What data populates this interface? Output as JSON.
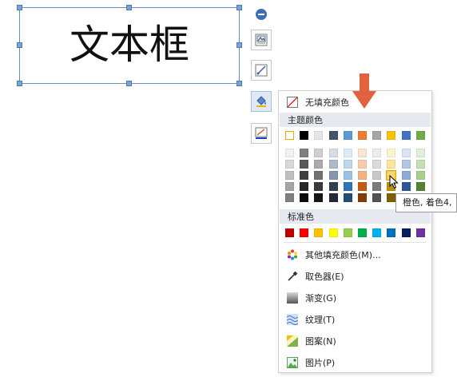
{
  "textbox": {
    "text": "文本框"
  },
  "dropdown": {
    "no_fill_label": "无填充颜色",
    "theme_colors_header": "主题颜色",
    "standard_colors_header": "标准色",
    "theme_top_row": [
      "#ffffff",
      "#000000",
      "#e7e6e6",
      "#44546a",
      "#5b9bd5",
      "#ed7d31",
      "#a5a5a5",
      "#ffc000",
      "#4472c4",
      "#70ad47"
    ],
    "theme_shades": [
      [
        "#f2f2f2",
        "#7f7f7f",
        "#d0cece",
        "#d6dce4",
        "#deebf6",
        "#fbe5d5",
        "#ededed",
        "#fff2cc",
        "#dae3f3",
        "#e2efd9"
      ],
      [
        "#d8d8d8",
        "#595959",
        "#aeaaaa",
        "#adb9ca",
        "#bdd7ee",
        "#f7cbac",
        "#dbdbdb",
        "#fee599",
        "#b4c6e7",
        "#c5e0b3"
      ],
      [
        "#bfbfbf",
        "#3f3f3f",
        "#757070",
        "#8496b0",
        "#9cc3e5",
        "#f4b183",
        "#c9c9c9",
        "#ffd965",
        "#8eaadb",
        "#a8d08d"
      ],
      [
        "#a5a5a5",
        "#262626",
        "#3a3838",
        "#323f4f",
        "#2e75b5",
        "#c55a11",
        "#7b7b7b",
        "#bf9000",
        "#2f5496",
        "#538135"
      ],
      [
        "#7f7f7f",
        "#0c0c0c",
        "#171616",
        "#222a35",
        "#1f4e79",
        "#833c0b",
        "#525252",
        "#7f6000",
        "#1f3864",
        "#375623"
      ]
    ],
    "standard_row": [
      "#c00000",
      "#ff0000",
      "#ffc000",
      "#ffff00",
      "#92d050",
      "#00b050",
      "#00b0f0",
      "#0070c0",
      "#002060",
      "#7030a0"
    ],
    "items": [
      {
        "label": "其他填充颜色(M)...",
        "icon": "color-wheel-icon"
      },
      {
        "label": "取色器(E)",
        "icon": "eyedropper-icon"
      },
      {
        "label": "渐变(G)",
        "icon": "gradient-icon"
      },
      {
        "label": "纹理(T)",
        "icon": "texture-icon"
      },
      {
        "label": "图案(N)",
        "icon": "pattern-icon"
      },
      {
        "label": "图片(P)",
        "icon": "picture-icon"
      }
    ]
  },
  "tooltip": {
    "text": "橙色, 着色4,"
  },
  "toolbar": {
    "icons": [
      "collapse-icon",
      "layout-icon",
      "edit-shape-icon",
      "fill-bucket-icon",
      "line-color-icon"
    ]
  }
}
